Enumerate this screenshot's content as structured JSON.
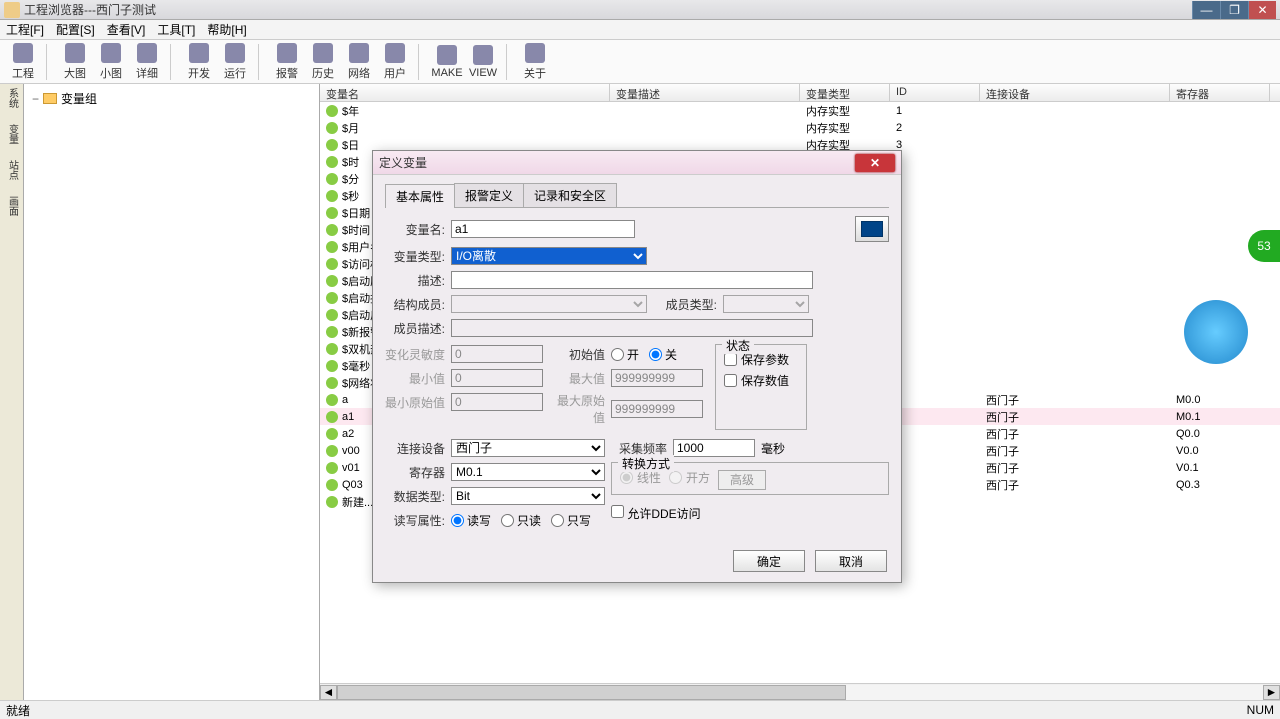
{
  "window": {
    "title": "工程浏览器---西门子测试"
  },
  "menu": [
    "工程[F]",
    "配置[S]",
    "查看[V]",
    "工具[T]",
    "帮助[H]"
  ],
  "toolbar": [
    {
      "label": "工程"
    },
    {
      "label": "大图"
    },
    {
      "label": "小图"
    },
    {
      "label": "详细"
    },
    {
      "label": "开发"
    },
    {
      "label": "运行"
    },
    {
      "label": "报警"
    },
    {
      "label": "历史"
    },
    {
      "label": "网络"
    },
    {
      "label": "用户"
    },
    {
      "label": "MAKE"
    },
    {
      "label": "VIEW"
    },
    {
      "label": "关于"
    }
  ],
  "vside": [
    "系统",
    "变量",
    "站点",
    "画面"
  ],
  "tree": {
    "root": "变量组"
  },
  "columns": {
    "name": "变量名",
    "desc": "变量描述",
    "type": "变量类型",
    "id": "ID",
    "dev": "连接设备",
    "reg": "寄存器"
  },
  "rows": [
    {
      "name": "$年",
      "type": "内存实型",
      "id": "1"
    },
    {
      "name": "$月",
      "type": "内存实型",
      "id": "2"
    },
    {
      "name": "$日",
      "type": "内存实型",
      "id": "3"
    },
    {
      "name": "$时"
    },
    {
      "name": "$分"
    },
    {
      "name": "$秒"
    },
    {
      "name": "$日期"
    },
    {
      "name": "$时间"
    },
    {
      "name": "$用户名"
    },
    {
      "name": "$访问权"
    },
    {
      "name": "$启动历"
    },
    {
      "name": "$启动报"
    },
    {
      "name": "$启动后"
    },
    {
      "name": "$新报警"
    },
    {
      "name": "$双机热"
    },
    {
      "name": "$毫秒"
    },
    {
      "name": "$网络状"
    },
    {
      "name": "a",
      "dev": "西门子",
      "reg": "M0.0"
    },
    {
      "name": "a1",
      "dev": "西门子",
      "reg": "M0.1",
      "sel": true
    },
    {
      "name": "a2",
      "dev": "西门子",
      "reg": "Q0.0"
    },
    {
      "name": "v00",
      "dev": "西门子",
      "reg": "V0.0"
    },
    {
      "name": "v01",
      "dev": "西门子",
      "reg": "V0.1"
    },
    {
      "name": "Q03",
      "dev": "西门子",
      "reg": "Q0.3"
    },
    {
      "name": "新建..."
    }
  ],
  "status": {
    "left": "就绪",
    "right": "NUM"
  },
  "dialog": {
    "title": "定义变量",
    "tabs": [
      "基本属性",
      "报警定义",
      "记录和安全区"
    ],
    "labels": {
      "varname": "变量名:",
      "vartype": "变量类型:",
      "desc": "描述:",
      "struct": "结构成员:",
      "memtype": "成员类型:",
      "memdesc": "成员描述:",
      "sens": "变化灵敏度",
      "min": "最小值",
      "minraw": "最小原始值",
      "init": "初始值",
      "on": "开",
      "off": "关",
      "max": "最大值",
      "maxraw": "最大原始值",
      "state": "状态",
      "saveparam": "保存参数",
      "savedata": "保存数值",
      "device": "连接设备",
      "freq": "采集频率",
      "ms": "毫秒",
      "register": "寄存器",
      "conv": "转换方式",
      "linear": "线性",
      "sqrt": "开方",
      "adv": "高级",
      "dtype": "数据类型:",
      "rwattr": "读写属性:",
      "rw": "读写",
      "ro": "只读",
      "wo": "只写",
      "dde": "允许DDE访问",
      "ok": "确定",
      "cancel": "取消"
    },
    "values": {
      "varname": "a1",
      "vartype": "I/O离散",
      "sens": "0",
      "min": "0",
      "minraw": "0",
      "max": "999999999",
      "maxraw": "999999999",
      "device": "西门子",
      "freq": "1000",
      "register": "M0.1",
      "dtype": "Bit"
    }
  }
}
